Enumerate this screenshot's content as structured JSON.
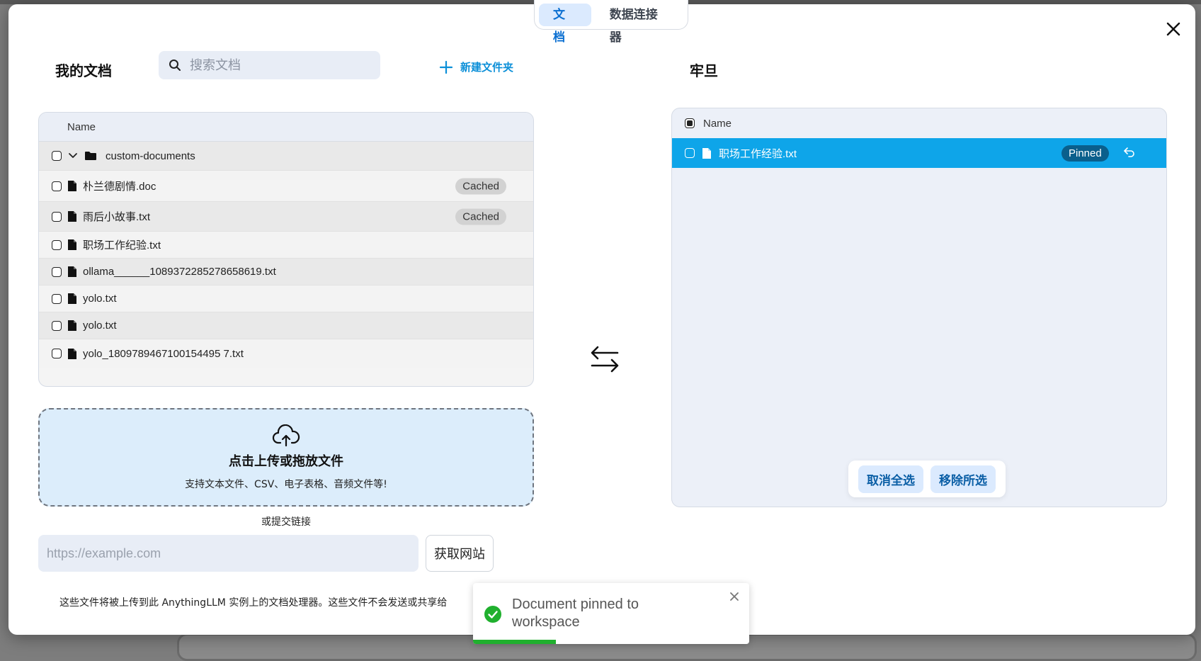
{
  "top_tabs": [
    {
      "label": "文档",
      "active": true
    },
    {
      "label": "数据连接器",
      "active": false
    }
  ],
  "left": {
    "title": "我的文档",
    "search_placeholder": "搜索文档",
    "new_folder_label": "新建文件夹",
    "column_name": "Name",
    "folder": {
      "name": "custom-documents",
      "expanded": true
    },
    "files": [
      {
        "name": "朴兰德剧情.doc",
        "badge": "Cached"
      },
      {
        "name": "雨后小故事.txt",
        "badge": "Cached"
      },
      {
        "name": "职场工作纪验.txt",
        "badge": ""
      },
      {
        "name": "ollama______1089372285278658619.txt",
        "badge": ""
      },
      {
        "name": "yolo.txt",
        "badge": ""
      },
      {
        "name": "yolo.txt",
        "badge": ""
      },
      {
        "name": "yolo_1809789467100154495 7.txt",
        "badge": ""
      }
    ]
  },
  "upload": {
    "title": "点击上传或拖放文件",
    "subtitle": "支持文本文件、CSV、电子表格、音频文件等!",
    "or_link": "或提交链接",
    "url_placeholder": "https://example.com",
    "fetch_label": "获取网站",
    "footer_note": "这些文件将被上传到此 AnythingLLM 实例上的文档处理器。这些文件不会发送或共享给"
  },
  "right": {
    "title": "牢旦",
    "column_name": "Name",
    "files": [
      {
        "name": "职场工作经验.txt",
        "badge": "Pinned"
      }
    ],
    "deselect_all_label": "取消全选",
    "remove_selected_label": "移除所选"
  },
  "toast": {
    "message": "Document pinned to workspace",
    "progress": 0.3
  },
  "colors": {
    "accent": "#0ea5e9",
    "toast_success": "#20b02e",
    "upload_bg": "#dcedfb"
  }
}
